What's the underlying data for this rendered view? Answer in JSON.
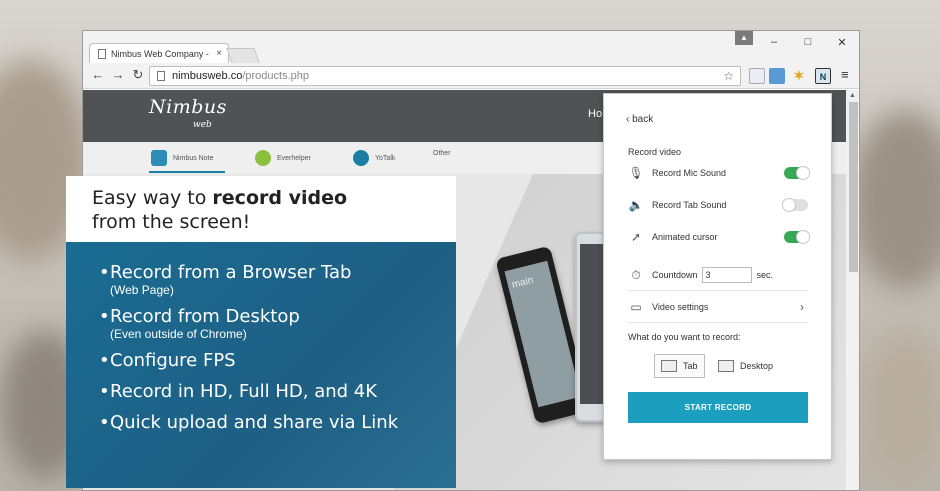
{
  "browser": {
    "tab_title": "Nimbus Web Company - N",
    "tab_close": "×",
    "user_badge": "▲",
    "window_controls": {
      "minimize": "–",
      "maximize": "□",
      "close": "✕"
    },
    "nav": {
      "back": "←",
      "forward": "→",
      "reload": "↻"
    },
    "url_host": "nimbusweb.co",
    "url_path": "/products.php",
    "star": "☆",
    "menu": "≡",
    "extensions": [
      "ext-a",
      "ext-b",
      "ext-c",
      "nimbus-ext"
    ],
    "nimbus_ext_label": "N"
  },
  "site": {
    "logo_main": "Nimbus",
    "logo_sub": "web",
    "nav_home": "Ho",
    "subnav": [
      {
        "label": "Nimbus Note",
        "color": "#2d8bb5"
      },
      {
        "label": "Everhelper",
        "color": "#8bbf3f"
      },
      {
        "label": "YoTalk",
        "color": "#1b7ea5"
      },
      {
        "label": "Other",
        "color": ""
      }
    ],
    "phone_title": "main"
  },
  "hero": {
    "line1_prefix": "Easy way to ",
    "line1_bold": "record video",
    "line2": "from the screen!",
    "bullets": [
      {
        "title": "Record from a Browser Tab",
        "sub": "(Web Page)"
      },
      {
        "title": "Record from Desktop",
        "sub": "(Even outside of Chrome)"
      },
      {
        "title": "Configure FPS",
        "sub": ""
      },
      {
        "title": "Record in HD, Full HD, and 4K",
        "sub": ""
      },
      {
        "title": "Quick upload and share via Link",
        "sub": ""
      }
    ]
  },
  "popup": {
    "back": "back",
    "section_title": "Record video",
    "options": [
      {
        "label": "Record Mic Sound",
        "icon": "microphone-icon",
        "on": true
      },
      {
        "label": "Record Tab Sound",
        "icon": "speaker-icon",
        "on": false
      },
      {
        "label": "Animated cursor",
        "icon": "cursor-icon",
        "on": true
      }
    ],
    "countdown_label": "Countdown",
    "countdown_value": "3",
    "countdown_unit": "sec.",
    "video_settings": "Video settings",
    "question": "What do you want to record:",
    "choice_tab": "Tab",
    "choice_desktop": "Desktop",
    "start_button": "START RECORD",
    "accent_color": "#1c9ebf",
    "toggle_on_color": "#3aa757"
  }
}
